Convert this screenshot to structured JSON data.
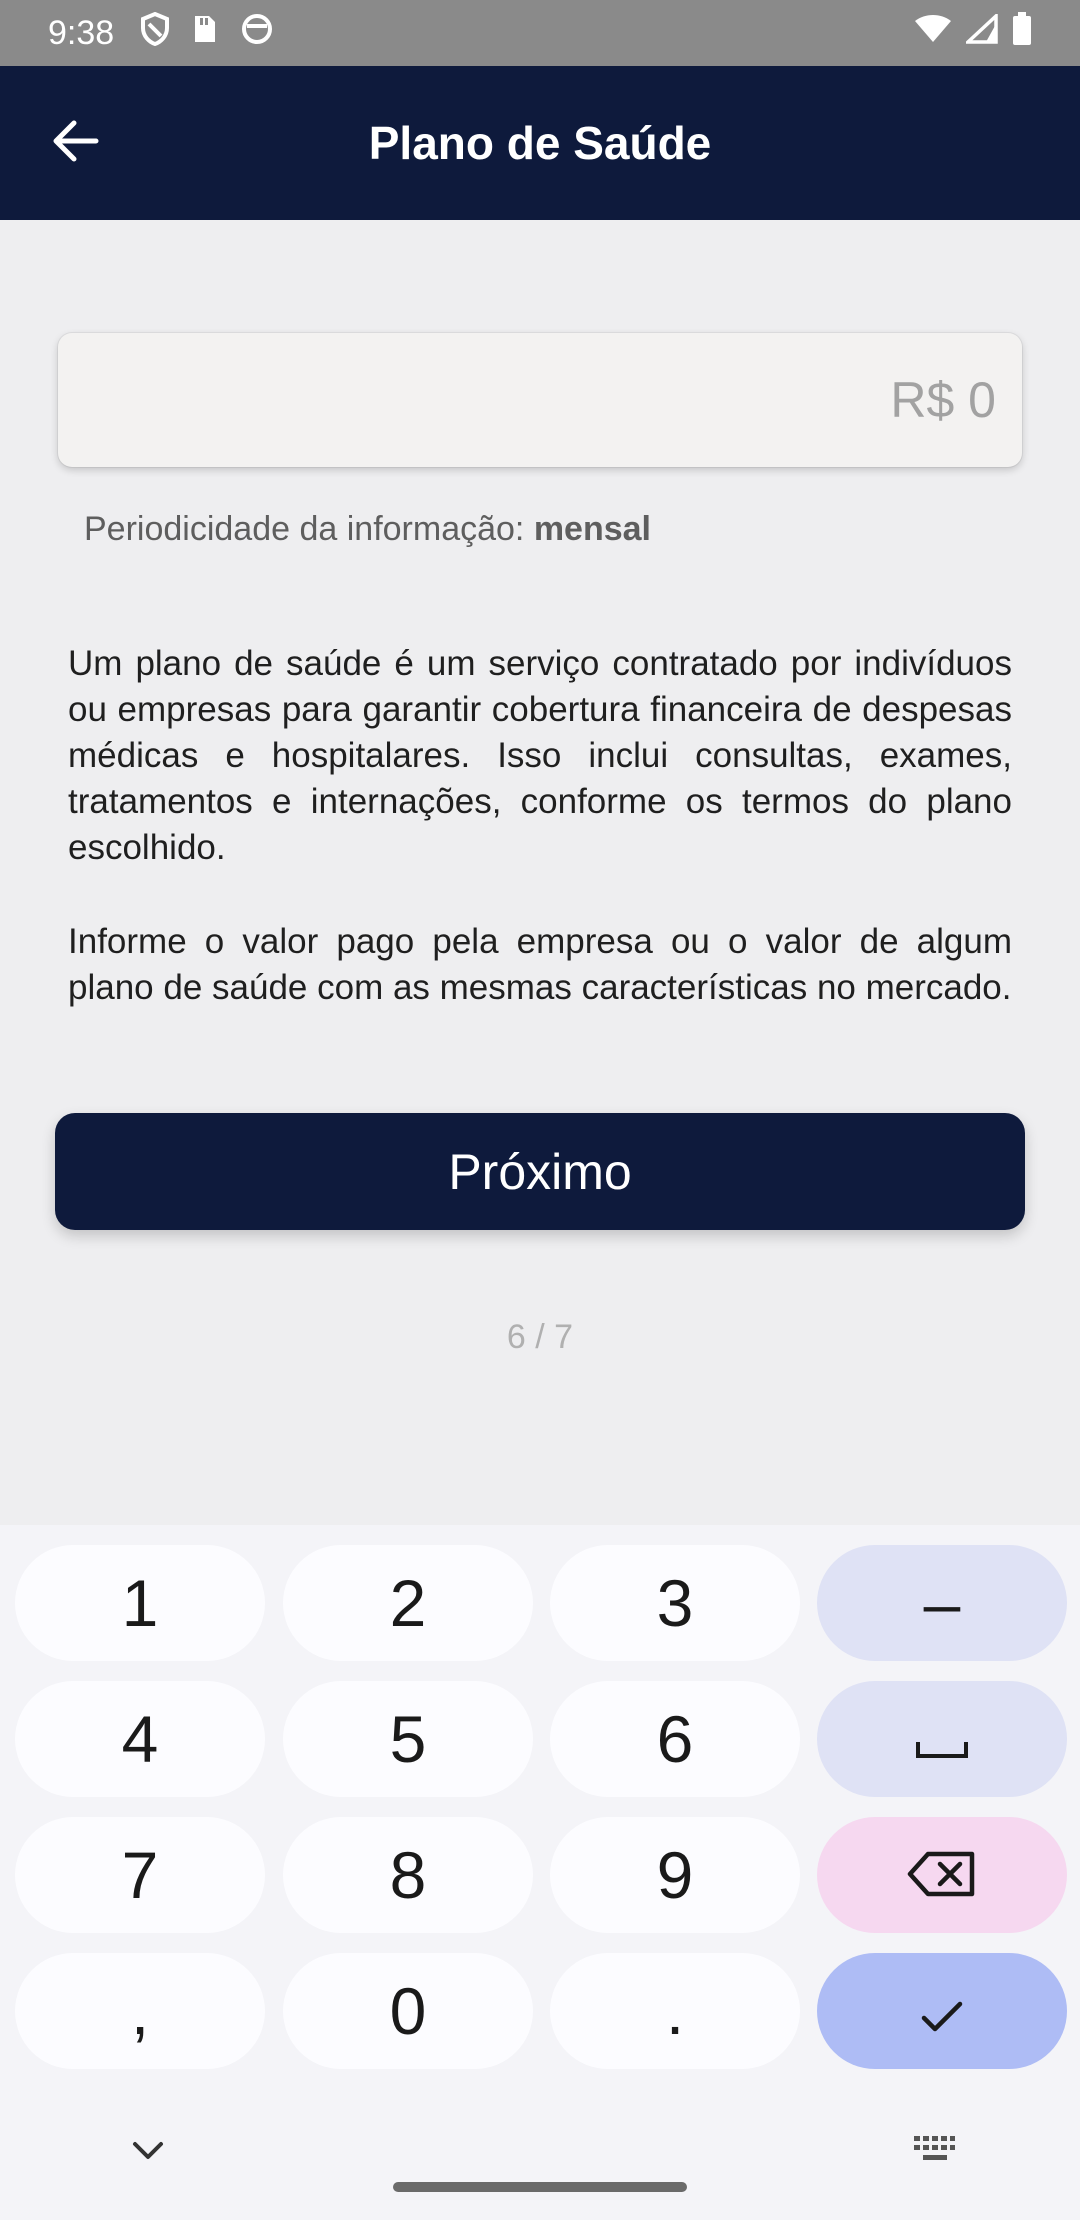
{
  "status_bar": {
    "time": "9:38",
    "icons_left": [
      "shield-icon",
      "sim-card-icon",
      "circle-app-icon"
    ],
    "icons_right": [
      "wifi-icon",
      "signal-icon",
      "battery-icon"
    ]
  },
  "app_bar": {
    "title": "Plano de Saúde",
    "back_icon": "arrow-left-icon"
  },
  "amount_field": {
    "value": "R$ 0"
  },
  "periodicity": {
    "label": "Periodicidade da informação: ",
    "value": "mensal"
  },
  "description": {
    "paragraph_1": "Um plano de saúde é um serviço contratado por indivíduos ou empresas para garantir cobertura financeira de despesas médicas e hospitalares. Isso inclui consultas, exames, tratamentos e internações, conforme os termos do plano escolhido.",
    "paragraph_2": "Informe o valor pago pela empresa ou o valor de algum plano de saúde com as mesmas características no mercado."
  },
  "next_button": {
    "label": "Próximo"
  },
  "step": {
    "text": "6 / 7"
  },
  "keyboard": {
    "keys": {
      "k1": "1",
      "k2": "2",
      "k3": "3",
      "minus": "–",
      "k4": "4",
      "k5": "5",
      "k6": "6",
      "k7": "7",
      "k8": "8",
      "k9": "9",
      "comma": ",",
      "k0": "0",
      "period": "."
    },
    "icons": [
      "space-icon",
      "backspace-icon",
      "check-icon",
      "chevron-down-icon",
      "keyboard-icon"
    ],
    "colors": {
      "key": "#fcfcff",
      "function_key": "#dfe2f5",
      "delete_key": "#f6d8f0",
      "enter_key": "#aebcf5"
    }
  },
  "colors": {
    "primary": "#0e1a3c",
    "background": "#eeeef0"
  }
}
